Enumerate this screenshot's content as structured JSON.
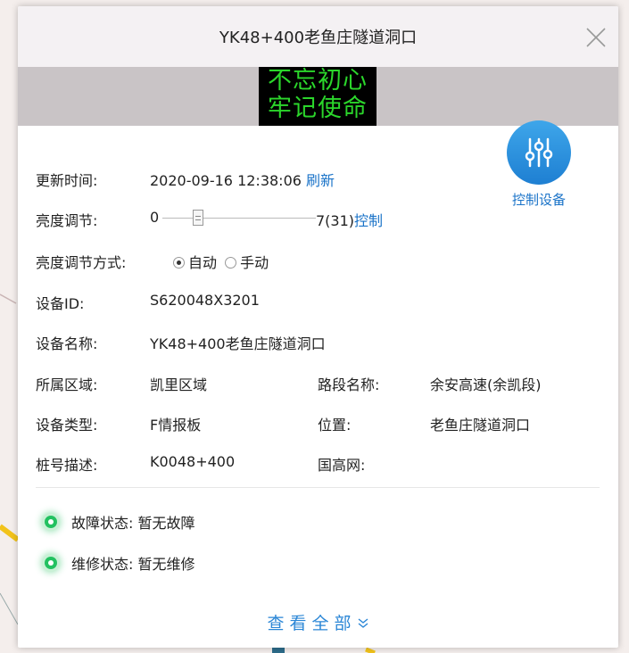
{
  "dialog": {
    "title": "YK48+400老鱼庄隧道洞口",
    "led_lines": [
      "不忘初心",
      "牢记使命"
    ],
    "control_button_label": "控制设备"
  },
  "fields": {
    "update_time": {
      "label": "更新时间:",
      "value": "2020-09-16 12:38:06",
      "action": "刷新"
    },
    "brightness": {
      "label": "亮度调节:",
      "min": "0",
      "max": "7(31)",
      "action": "控制",
      "level_fraction": 0.29
    },
    "brightness_mode": {
      "label": "亮度调节方式:",
      "options": [
        "自动",
        "手动"
      ],
      "selected": "自动"
    },
    "device_id": {
      "label": "设备ID:",
      "value": "S620048X3201"
    },
    "device_name": {
      "label": "设备名称:",
      "value": "YK48+400老鱼庄隧道洞口"
    },
    "region": {
      "label": "所属区域:",
      "value": "凯里区域"
    },
    "road_section": {
      "label": "路段名称:",
      "value": "余安高速(余凯段)"
    },
    "device_type": {
      "label": "设备类型:",
      "value": "F情报板"
    },
    "location": {
      "label": "位置:",
      "value": "老鱼庄隧道洞口"
    },
    "stake": {
      "label": "桩号描述:",
      "value": "K0048+400"
    },
    "national_net": {
      "label": "国高网:",
      "value": ""
    }
  },
  "status": {
    "fault": "故障状态: 暂无故障",
    "repair": "维修状态: 暂无维修"
  },
  "view_all": "查看全部",
  "colors": {
    "accent": "#1a73c8",
    "led_text": "#2bd62b",
    "status_ok": "#22c160"
  }
}
